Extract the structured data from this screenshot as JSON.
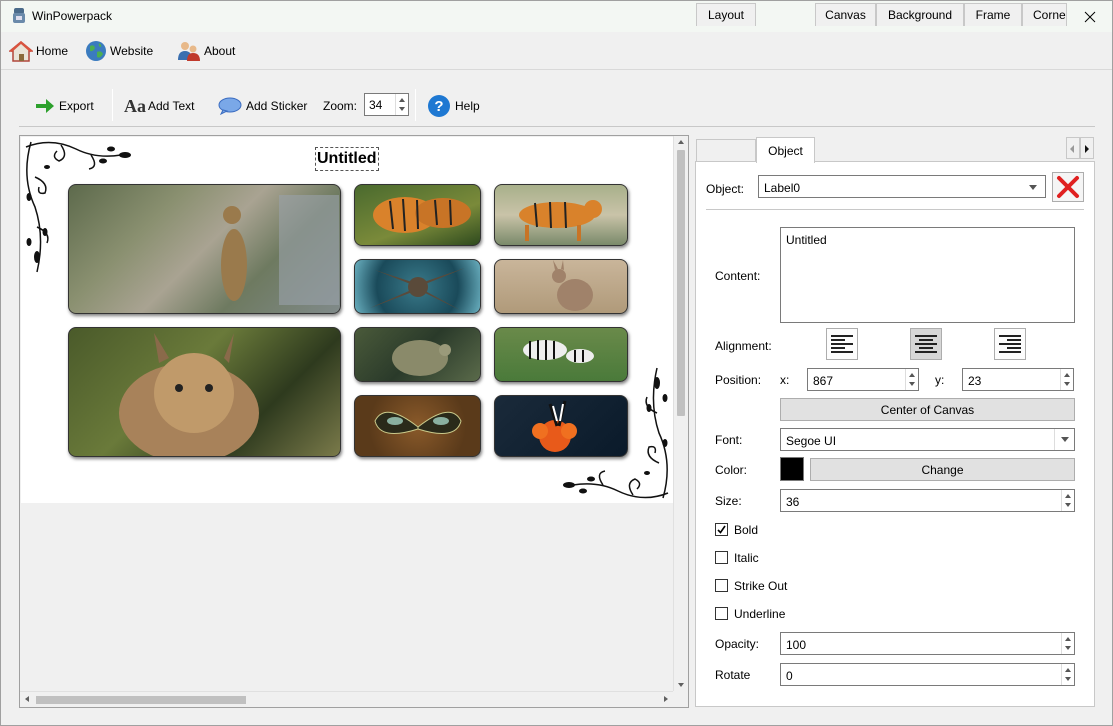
{
  "window": {
    "title": "WinPowerpack"
  },
  "menu": {
    "home": "Home",
    "website": "Website",
    "about": "About"
  },
  "toolbar": {
    "export": "Export",
    "add_text": "Add Text",
    "add_sticker": "Add Sticker",
    "zoom_label": "Zoom:",
    "zoom_value": "34",
    "help": "Help"
  },
  "canvas": {
    "title": "Untitled",
    "photos": [
      "ground-squirrel",
      "tigers-in-grass",
      "tiger-walking",
      "starfish",
      "kangaroo",
      "lynx",
      "chameleon",
      "zebras",
      "butterfly",
      "butterfly-on-flower"
    ]
  },
  "tabs": [
    "Layout",
    "Object",
    "Canvas",
    "Background",
    "Frame",
    "Corne"
  ],
  "object_panel": {
    "object_label": "Object:",
    "object_value": "Label0",
    "content_label": "Content:",
    "content_value": "Untitled",
    "alignment_label": "Alignment:",
    "position_label": "Position:",
    "x_label": "x:",
    "x_value": "867",
    "y_label": "y:",
    "y_value": "23",
    "center_button": "Center of Canvas",
    "font_label": "Font:",
    "font_value": "Segoe UI",
    "color_label": "Color:",
    "color_value": "#000000",
    "change_button": "Change",
    "size_label": "Size:",
    "size_value": "36",
    "bold_label": "Bold",
    "bold_checked": true,
    "italic_label": "Italic",
    "strikeout_label": "Strike Out",
    "underline_label": "Underline",
    "opacity_label": "Opacity:",
    "opacity_value": "100",
    "rotate_label": "Rotate",
    "rotate_value": "0"
  },
  "colors": {
    "accent_green": "#2ca02c",
    "delete_red": "#e02020",
    "help_blue": "#1e78d2"
  }
}
